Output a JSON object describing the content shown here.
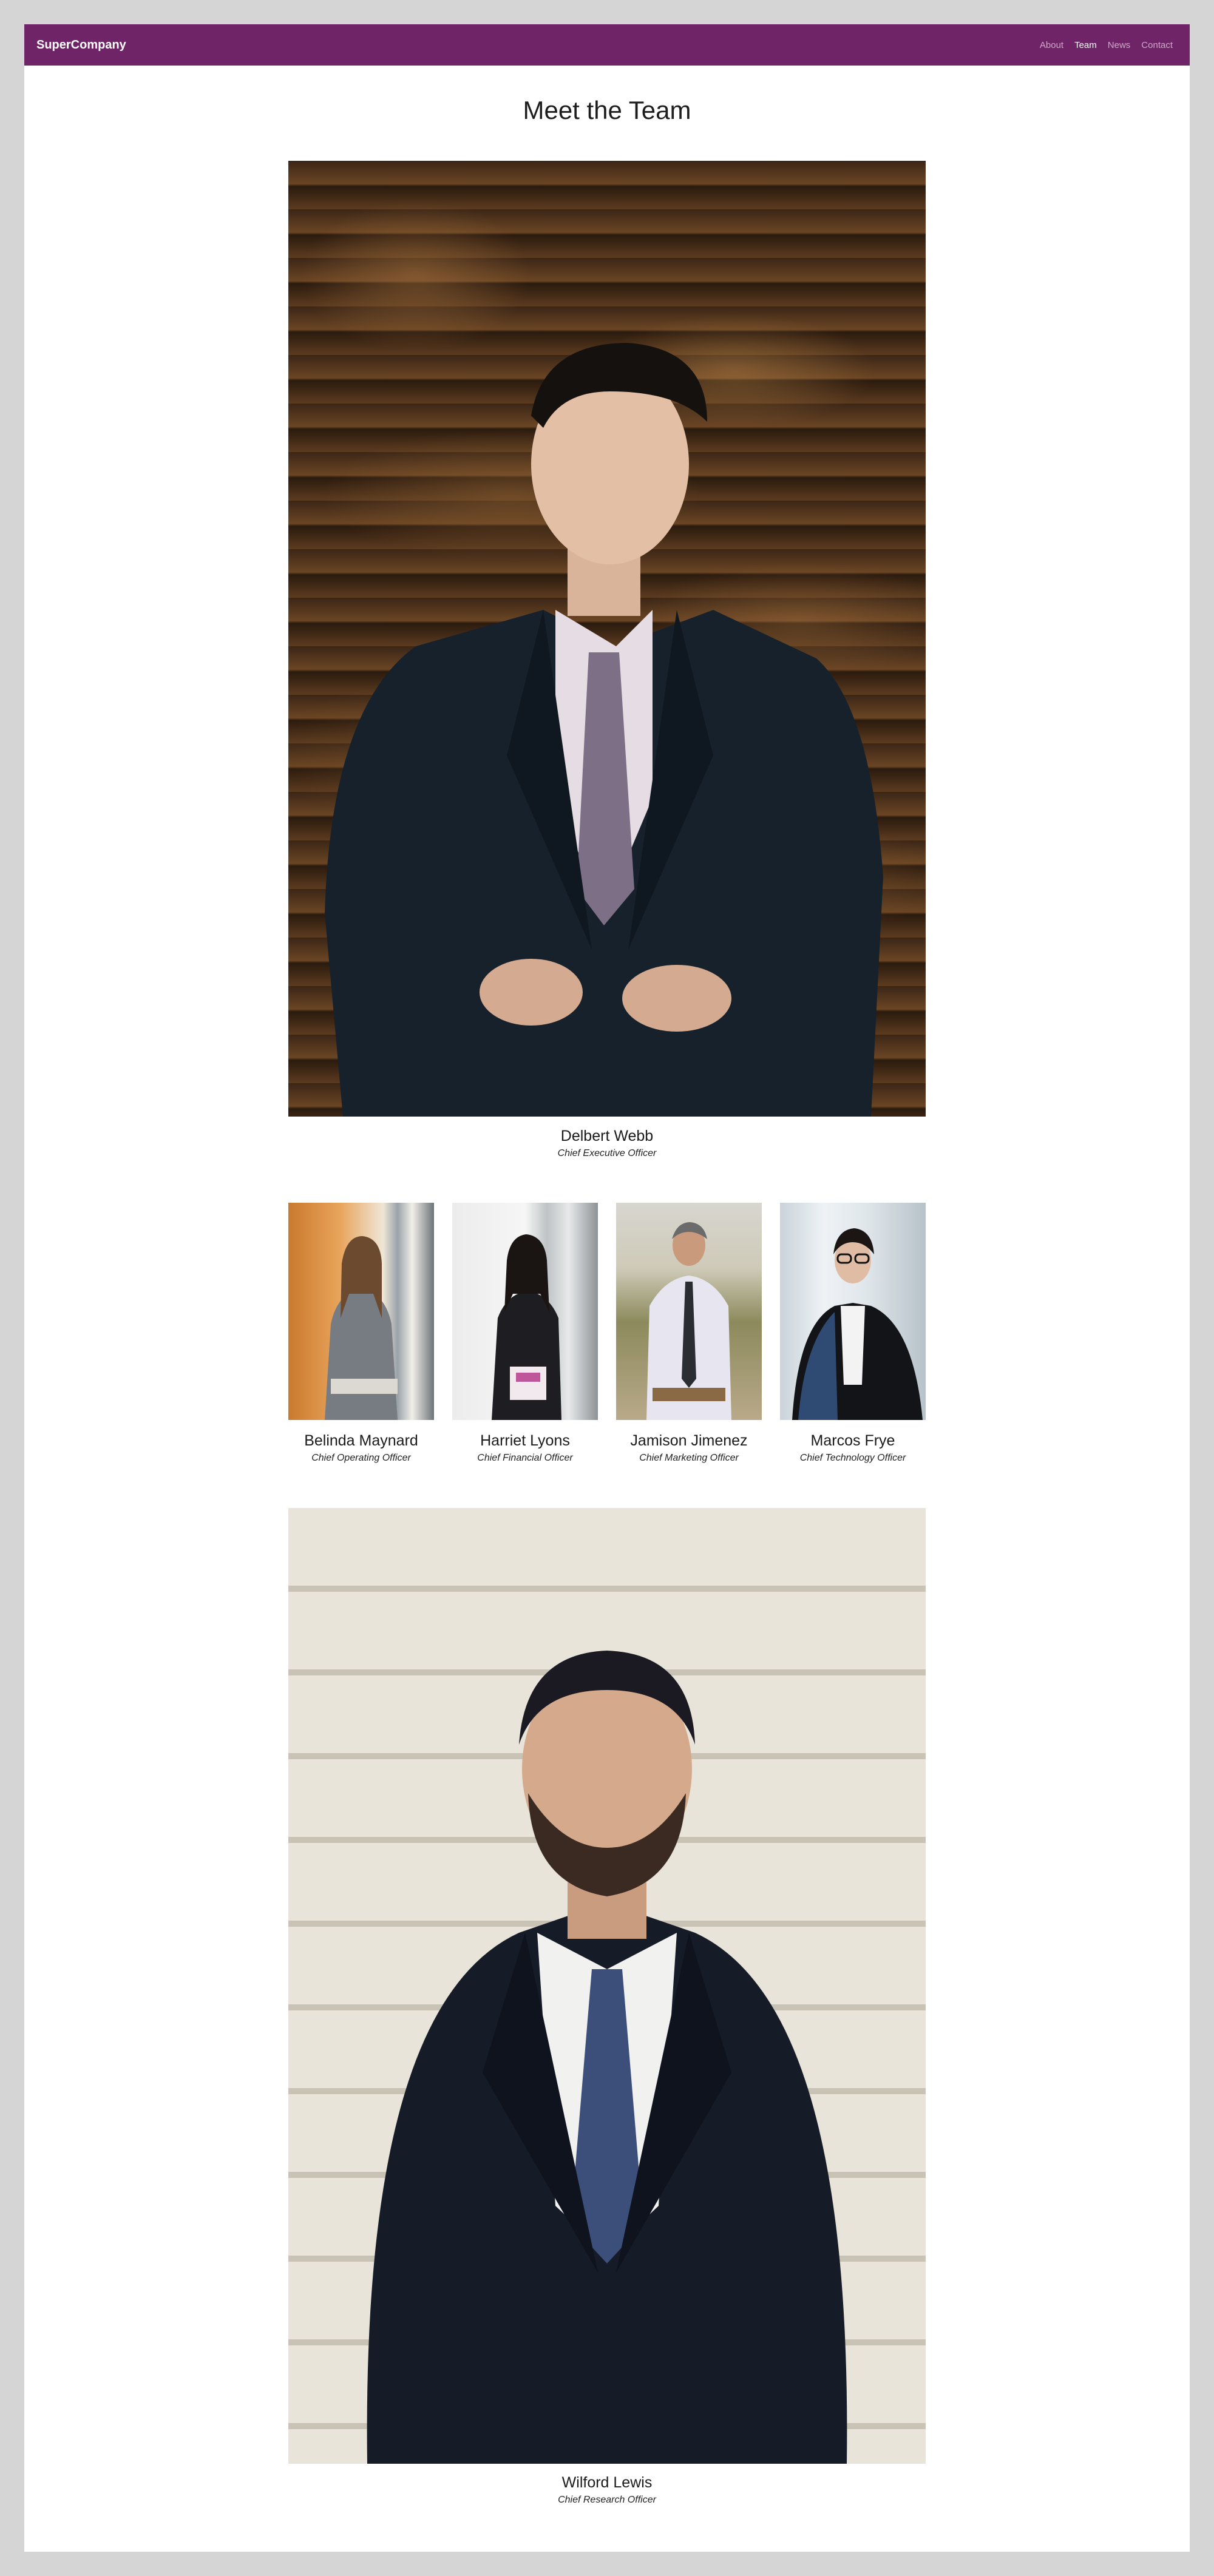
{
  "brand": "SuperCompany",
  "nav": {
    "items": [
      "About",
      "Team",
      "News",
      "Contact"
    ],
    "active": "Team"
  },
  "page_title": "Meet the Team",
  "team": {
    "lead": {
      "name": "Delbert Webb",
      "role": "Chief Executive Officer"
    },
    "members": [
      {
        "name": "Belinda Maynard",
        "role": "Chief Operating Officer"
      },
      {
        "name": "Harriet Lyons",
        "role": "Chief Financial Officer"
      },
      {
        "name": "Jamison Jimenez",
        "role": "Chief Marketing Officer"
      },
      {
        "name": "Marcos Frye",
        "role": "Chief Technology Officer"
      }
    ],
    "footer_member": {
      "name": "Wilford Lewis",
      "role": "Chief Research Officer"
    }
  },
  "colors": {
    "navbar": "#6e2466",
    "page_background": "#d6d5d6",
    "content_background": "#ffffff"
  }
}
